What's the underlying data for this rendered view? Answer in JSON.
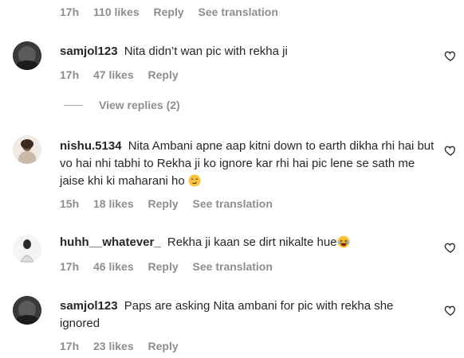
{
  "top_meta": {
    "time": "17h",
    "likes": "110 likes",
    "reply": "Reply",
    "translate": "See translation"
  },
  "comments": [
    {
      "user": "samjol123",
      "text": "Nita didn’t wan pic with rekha ji",
      "time": "17h",
      "likes": "47 likes",
      "reply": "Reply"
    },
    {
      "user": "nishu.5134",
      "text": "Nita Ambani apne aap kitni down to earth dikha rhi hai but vo hai nhi tabhi to Rekha ji ko ignore kar rhi hai pic lene se sath me jaise khi ki maharani ho",
      "time": "15h",
      "likes": "18 likes",
      "reply": "Reply",
      "translate": "See translation"
    },
    {
      "user": "huhh__whatever_",
      "text": "Rekha ji kaan se dirt nikalte hue",
      "time": "17h",
      "likes": "46 likes",
      "reply": "Reply",
      "translate": "See translation"
    },
    {
      "user": "samjol123",
      "text": "Paps are asking Nita ambani for pic with rekha she ignored",
      "time": "17h",
      "likes": "23 likes",
      "reply": "Reply"
    }
  ],
  "view_replies": "View replies (2)",
  "icons": {
    "like": "heart-outline-icon",
    "emoji_smirk": "smirking-face-emoji",
    "emoji_laugh": "laughing-face-emoji"
  }
}
